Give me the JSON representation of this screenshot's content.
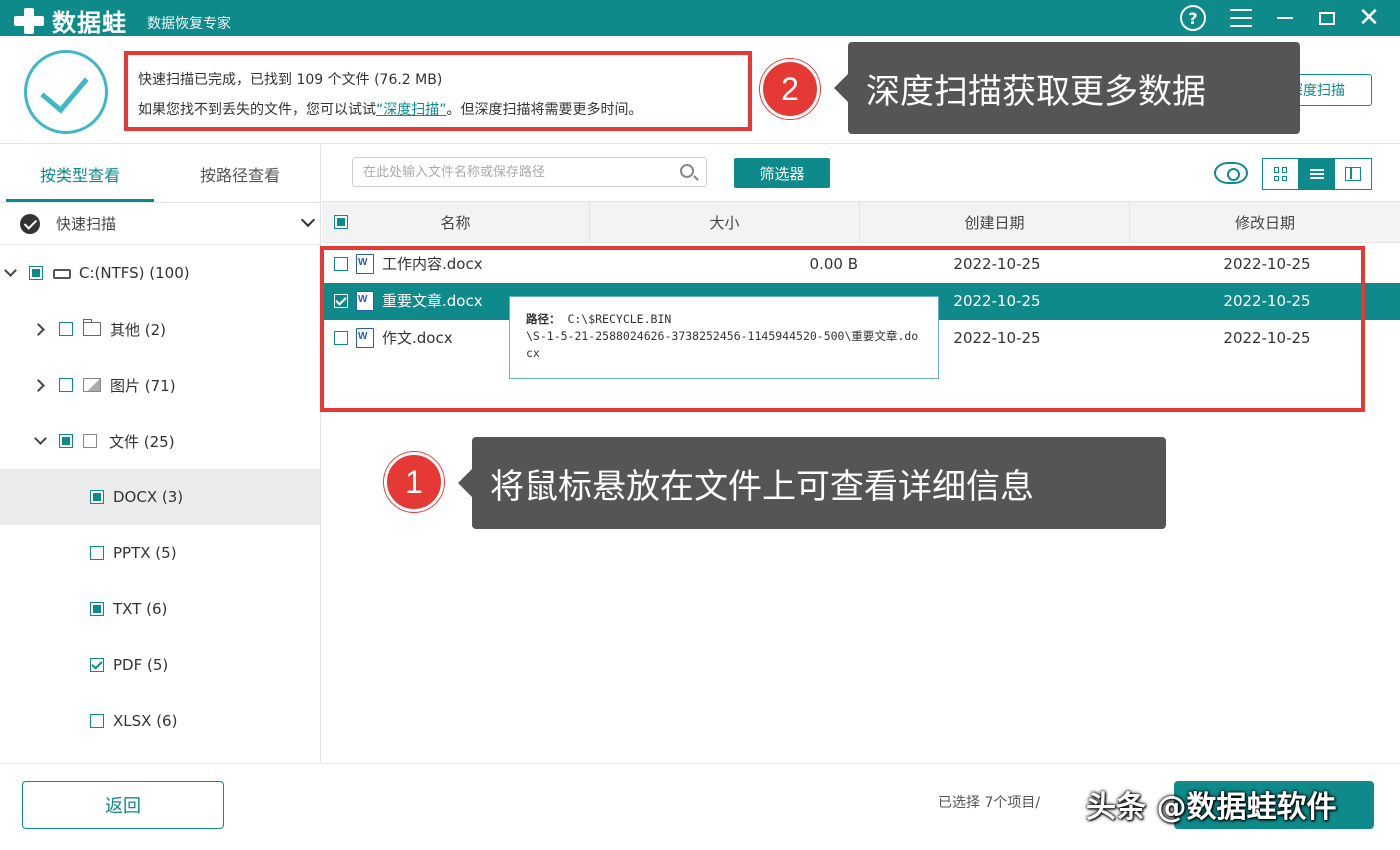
{
  "app": {
    "name": "数据蛙",
    "subtitle": "数据恢复专家"
  },
  "window_controls": {
    "help_glyph": "?",
    "close_glyph": "✕"
  },
  "scan_info": {
    "line1": "快速扫描已完成，已找到 109 个文件 (76.2 MB)",
    "line2_prefix": "如果您找不到丢失的文件，您可以试试",
    "deep_scan_link": "“深度扫描”",
    "line2_suffix": "。但深度扫描将需要更多时间。",
    "deep_scan_button": "深度扫描"
  },
  "callouts": {
    "badge2": "2",
    "text2": "深度扫描获取更多数据",
    "badge1": "1",
    "text1": "将鼠标悬放在文件上可查看详细信息"
  },
  "left_panel": {
    "tabs": [
      "按类型查看",
      "按路径查看"
    ],
    "scan_mode": "快速扫描",
    "tree": [
      {
        "label": "C:(NTFS) (100)"
      },
      {
        "label": "其他 (2)"
      },
      {
        "label": "图片 (71)"
      },
      {
        "label": "文件 (25)"
      },
      {
        "label": "DOCX (3)"
      },
      {
        "label": "PPTX (5)"
      },
      {
        "label": "TXT (6)"
      },
      {
        "label": "PDF (5)"
      },
      {
        "label": "XLSX (6)"
      }
    ]
  },
  "toolbar": {
    "search_placeholder": "在此处输入文件名称或保存路径",
    "filter_button": "筛选器"
  },
  "table": {
    "columns": [
      "名称",
      "大小",
      "创建日期",
      "修改日期"
    ],
    "rows": [
      {
        "name": "工作内容.docx",
        "size": "0.00  B",
        "created": "2022-10-25",
        "modified": "2022-10-25"
      },
      {
        "name": "重要文章.docx",
        "size": "",
        "created": "2022-10-25",
        "modified": "2022-10-25"
      },
      {
        "name": "作文.docx",
        "size": "",
        "created": "2022-10-25",
        "modified": "2022-10-25"
      }
    ]
  },
  "tooltip": {
    "label": "路径：",
    "path_line1": "C:\\$RECYCLE.BIN",
    "path_line2": "\\S-1-5-21-2588024626-3738252456-1145944520-500\\重要文章.docx"
  },
  "bottom": {
    "back_button": "返回",
    "selected_info": "已选择 7个项目/",
    "watermark": "头条 @数据蛙软件"
  },
  "colors": {
    "primary": "#0f8a8a",
    "highlight_red": "#e53935",
    "callout_bg": "#555555"
  }
}
